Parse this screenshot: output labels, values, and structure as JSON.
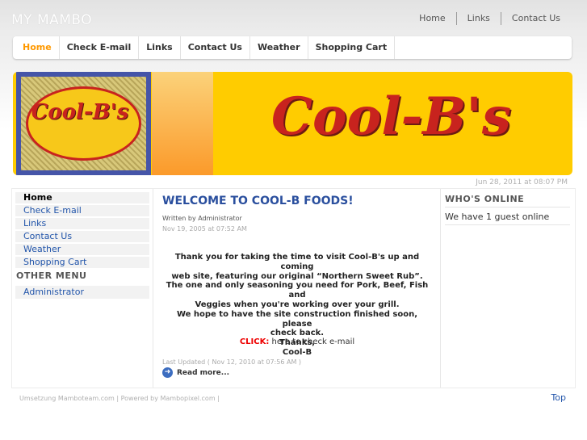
{
  "site": {
    "title": "MY MAMBO"
  },
  "toplinks": [
    "Home",
    "Links",
    "Contact Us"
  ],
  "nav": [
    "Home",
    "Check E-mail",
    "Links",
    "Contact Us",
    "Weather",
    "Shopping Cart"
  ],
  "banner": {
    "logo_text": "Cool-B's",
    "big_text": "Cool-B's"
  },
  "date": "Jun 28, 2011 at 08:07 PM",
  "leftmenu": {
    "items": [
      "Home",
      "Check E-mail",
      "Links",
      "Contact Us",
      "Weather",
      "Shopping Cart"
    ],
    "other_title": "OTHER MENU",
    "other_items": [
      "Administrator"
    ]
  },
  "article": {
    "title": "WELCOME TO COOL-B FOODS!",
    "written_by": "Written by Administrator",
    "created": "Nov 19, 2005 at 07:52 AM",
    "body": [
      "Thank you for taking the time to visit Cool-B's up and coming",
      "web site, featuring our original “Northern Sweet Rub”.",
      "The one and only seasoning you need for Pork, Beef, Fish and",
      "Veggies when you're working over your grill.",
      "We hope to have the site construction finished soon, please",
      "check back.",
      "Thanks,",
      "Cool-B"
    ],
    "click_label": "CLICK:",
    "click_text": " here to check e-mail",
    "updated": "Last Updated ( Nov 12, 2010 at 07:56 AM )",
    "read_more": "Read more..."
  },
  "whos_online": {
    "title": "WHO'S ONLINE",
    "text": "We have 1 guest online"
  },
  "footer": {
    "text": "Umsetzung Mamboteam.com | Powered by Mambopixel.com |",
    "top_link": "Top"
  },
  "colors": {
    "accent": "#ff9900",
    "link": "#2255aa",
    "title": "#2a4f9e",
    "banner": "#ffcc00",
    "logo_red": "#c8231e"
  }
}
